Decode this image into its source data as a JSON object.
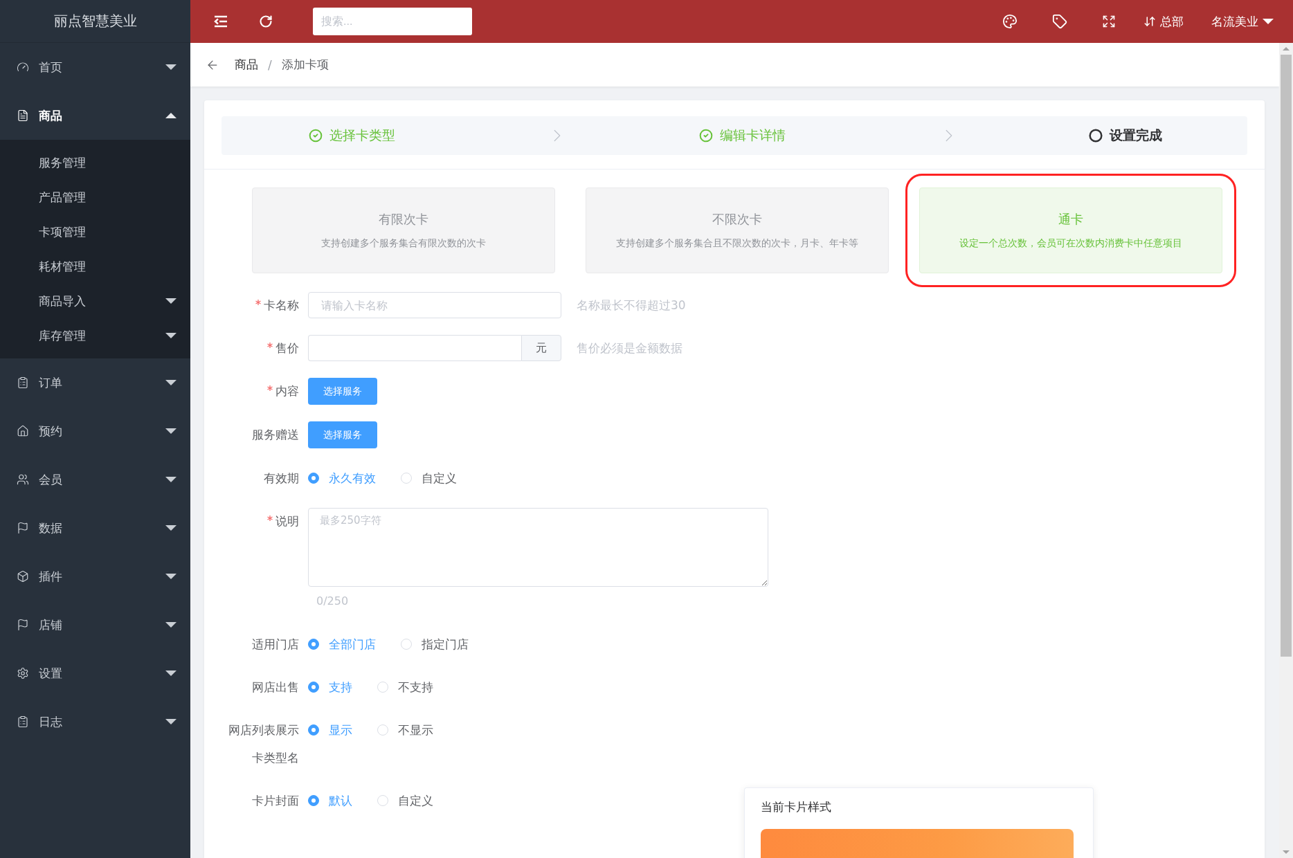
{
  "sidebar": {
    "logo": "丽点智慧美业",
    "items": [
      {
        "label": "首页",
        "expanded": false,
        "selected": false
      },
      {
        "label": "商品",
        "expanded": true,
        "selected": true,
        "children": [
          {
            "label": "服务管理"
          },
          {
            "label": "产品管理"
          },
          {
            "label": "卡项管理"
          },
          {
            "label": "耗材管理"
          },
          {
            "label": "商品导入",
            "expanded": false
          },
          {
            "label": "库存管理",
            "expanded": false
          }
        ]
      },
      {
        "label": "订单",
        "expanded": false,
        "selected": false
      },
      {
        "label": "预约",
        "expanded": false,
        "selected": false
      },
      {
        "label": "会员",
        "expanded": false,
        "selected": false
      },
      {
        "label": "数据",
        "expanded": false,
        "selected": false
      },
      {
        "label": "插件",
        "expanded": false,
        "selected": false
      },
      {
        "label": "店铺",
        "expanded": false,
        "selected": false
      },
      {
        "label": "设置",
        "expanded": false,
        "selected": false
      },
      {
        "label": "日志",
        "expanded": false,
        "selected": false
      }
    ]
  },
  "header": {
    "search": {
      "placeholder": "搜索..."
    },
    "branch": "总部",
    "user": "名流美业"
  },
  "breadcrumb": {
    "items": [
      "商品",
      "添加卡项"
    ],
    "separator": "/"
  },
  "steps": [
    {
      "label": "选择卡类型",
      "done": true
    },
    {
      "label": "编辑卡详情",
      "done": true
    },
    {
      "label": "设置完成",
      "done": false
    }
  ],
  "card_types": [
    {
      "title": "有限次卡",
      "description": "支持创建多个服务集合有限次数的次卡",
      "selected": false
    },
    {
      "title": "不限次卡",
      "description": "支持创建多个服务集合且不限次数的次卡，月卡、年卡等",
      "selected": false
    },
    {
      "title": "通卡",
      "description": "设定一个总次数，会员可在次数内消费卡中任意项目",
      "selected": true
    }
  ],
  "fields": [
    {
      "kind": "text",
      "label": "卡名称",
      "required": true,
      "placeholder": "请输入卡名称",
      "hint": "名称最长不得超过30"
    },
    {
      "kind": "price",
      "label": "售价",
      "required": true,
      "suffix": "元",
      "hint": "售价必须是金额数据"
    },
    {
      "kind": "button",
      "label": "内容",
      "required": true,
      "button": "选择服务"
    },
    {
      "kind": "button",
      "label": "服务赠送",
      "required": false,
      "button": "选择服务"
    },
    {
      "kind": "radio",
      "label": "有效期",
      "required": false,
      "options": [
        {
          "label": "永久有效",
          "selected": true
        },
        {
          "label": "自定义",
          "selected": false
        }
      ]
    },
    {
      "kind": "textarea",
      "label": "说明",
      "required": true,
      "placeholder": "最多250字符",
      "counter": "0/250"
    },
    {
      "kind": "radio",
      "label": "适用门店",
      "required": false,
      "options": [
        {
          "label": "全部门店",
          "selected": true
        },
        {
          "label": "指定门店",
          "selected": false
        }
      ]
    },
    {
      "kind": "radio",
      "label": "网店出售",
      "required": false,
      "options": [
        {
          "label": "支持",
          "selected": true
        },
        {
          "label": "不支持",
          "selected": false
        }
      ]
    },
    {
      "kind": "radio",
      "label": "网店列表展示",
      "required": false,
      "options": [
        {
          "label": "显示",
          "selected": true
        },
        {
          "label": "不显示",
          "selected": false
        }
      ]
    },
    {
      "kind": "label",
      "label": "卡类型名",
      "required": false
    },
    {
      "kind": "radio",
      "label": "卡片封面",
      "required": false,
      "options": [
        {
          "label": "默认",
          "selected": true
        },
        {
          "label": "自定义",
          "selected": false
        }
      ],
      "preview": {
        "title": "当前卡片样式"
      }
    }
  ]
}
